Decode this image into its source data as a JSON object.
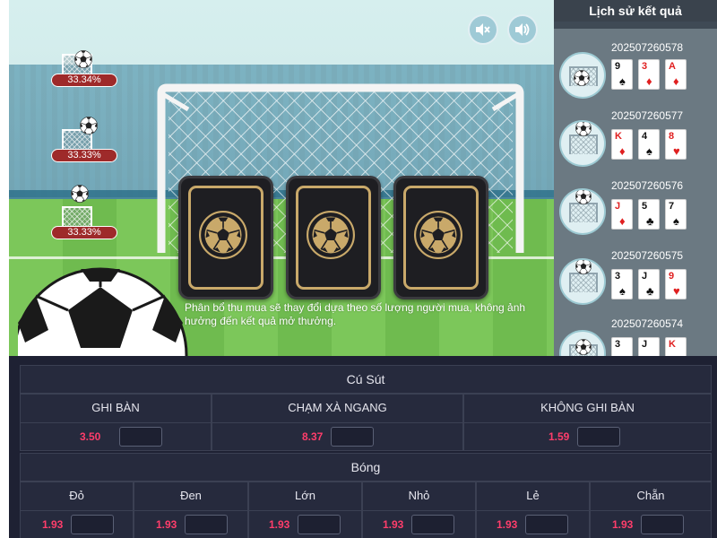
{
  "controls": {
    "mute_icon": "mute-icon",
    "volume_icon": "volume-icon"
  },
  "goal_options": [
    {
      "percent": "33.34%"
    },
    {
      "percent": "33.33%"
    },
    {
      "percent": "33.33%"
    }
  ],
  "cards": [
    {
      "icon": "soccer-ball-icon"
    },
    {
      "icon": "soccer-ball-icon"
    },
    {
      "icon": "soccer-ball-icon"
    }
  ],
  "notice": "Phân bổ thu mua sẽ thay đổi dựa theo số lượng người mua, không ảnh hưởng đến kết quả mở thưởng.",
  "history": {
    "title": "Lịch sử kết quả",
    "items": [
      {
        "id": "202507260578",
        "cards": [
          {
            "rank": "9",
            "suit": "♠"
          },
          {
            "rank": "3",
            "suit": "♦"
          },
          {
            "rank": "A",
            "suit": "♦"
          }
        ]
      },
      {
        "id": "202507260577",
        "cards": [
          {
            "rank": "K",
            "suit": "♦"
          },
          {
            "rank": "4",
            "suit": "♠"
          },
          {
            "rank": "8",
            "suit": "♥"
          }
        ]
      },
      {
        "id": "202507260576",
        "cards": [
          {
            "rank": "J",
            "suit": "♦"
          },
          {
            "rank": "5",
            "suit": "♣"
          },
          {
            "rank": "7",
            "suit": "♠"
          }
        ]
      },
      {
        "id": "202507260575",
        "cards": [
          {
            "rank": "3",
            "suit": "♠"
          },
          {
            "rank": "J",
            "suit": "♣"
          },
          {
            "rank": "9",
            "suit": "♥"
          }
        ]
      },
      {
        "id": "202507260574",
        "cards": [
          {
            "rank": "3",
            "suit": ""
          },
          {
            "rank": "J",
            "suit": ""
          },
          {
            "rank": "K",
            "suit": ""
          }
        ]
      }
    ]
  },
  "bets": {
    "cu_sut": {
      "title": "Cú Sút",
      "options": [
        {
          "label": "GHI BÀN",
          "odds": "3.50",
          "amount": ""
        },
        {
          "label": "CHẠM XÀ NGANG",
          "odds": "8.37",
          "amount": ""
        },
        {
          "label": "KHÔNG GHI BÀN",
          "odds": "1.59",
          "amount": ""
        }
      ]
    },
    "bong": {
      "title": "Bóng",
      "options": [
        {
          "label": "Đỏ",
          "odds": "1.93",
          "amount": ""
        },
        {
          "label": "Đen",
          "odds": "1.93",
          "amount": ""
        },
        {
          "label": "Lớn",
          "odds": "1.93",
          "amount": ""
        },
        {
          "label": "Nhỏ",
          "odds": "1.93",
          "amount": ""
        },
        {
          "label": "Lẻ",
          "odds": "1.93",
          "amount": ""
        },
        {
          "label": "Chẵn",
          "odds": "1.93",
          "amount": ""
        }
      ]
    }
  },
  "colors": {
    "odds": "#ff3d6b",
    "badge": "#9e2a2a",
    "card_border": "#c9a96a",
    "panel": "#1e2133"
  }
}
